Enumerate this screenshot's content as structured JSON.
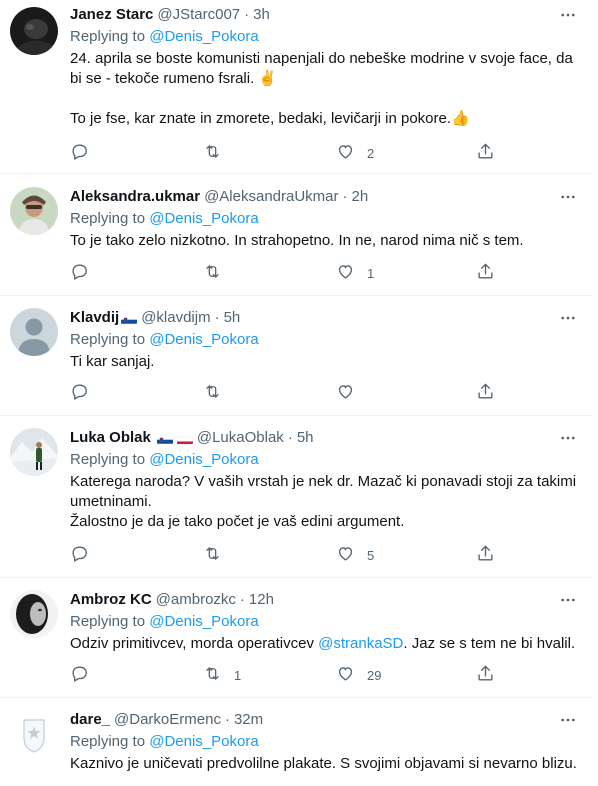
{
  "replying_to_label": "Replying to",
  "tweets": [
    {
      "name": "Janez Starc",
      "handle": "@JStarc007",
      "sep": "·",
      "time": "3h",
      "reply_to": "@Denis_Pokora",
      "lines": [
        "24. aprila se boste komunisti napenjali do nebeške modrine v svoje face, da",
        "bi se - tekoče rumeno fsrali. ✌️",
        "To je fse, kar znate in zmorete, bedaki, levičarji in pokore.👍"
      ],
      "retweets": "",
      "likes": "2"
    },
    {
      "name": "Aleksandra.ukmar",
      "handle": "@AleksandraUkmar",
      "sep": "·",
      "time": "2h",
      "reply_to": "@Denis_Pokora",
      "lines": [
        "To je tako zelo nizkotno. In strahopetno. In ne, narod nima nič s tem."
      ],
      "retweets": "",
      "likes": "1"
    },
    {
      "name": "Klavdij",
      "handle": "@klavdijm",
      "sep": "·",
      "time": "5h",
      "reply_to": "@Denis_Pokora",
      "lines": [
        "Ti kar sanjaj."
      ],
      "retweets": "",
      "likes": ""
    },
    {
      "name": "Luka Oblak",
      "handle": "@LukaOblak",
      "sep": "·",
      "time": "5h",
      "reply_to": "@Denis_Pokora",
      "lines": [
        "Katerega naroda? V vaših vrstah je nek dr. Mazač ki ponavadi stoji za takimi",
        "umetninami.",
        "Žalostno je da je tako počet je vaš edini argument."
      ],
      "retweets": "",
      "likes": "5"
    },
    {
      "name": "Ambroz KC",
      "handle": "@ambrozkc",
      "sep": "·",
      "time": "12h",
      "reply_to": "@Denis_Pokora",
      "text_before": "Odziv primitivcev, morda operativcev ",
      "text_mention": "@strankaSD",
      "text_after": ". Jaz se s tem ne bi hvalil.",
      "retweets": "1",
      "likes": "29"
    },
    {
      "name": "dare_",
      "handle": "@DarkoErmenc",
      "sep": "·",
      "time": "32m",
      "reply_to": "@Denis_Pokora",
      "lines": [
        "Kaznivo je uničevati predvolilne plakate. S svojimi objavami si nevarno blizu."
      ],
      "retweets": "",
      "likes": ""
    }
  ],
  "colors": {
    "accent": "#1d9bf0",
    "muted": "#536471",
    "text": "#0f1419",
    "divider": "#eff3f4"
  },
  "icons": [
    "more-icon",
    "reply-icon",
    "retweet-icon",
    "like-icon",
    "share-icon"
  ]
}
